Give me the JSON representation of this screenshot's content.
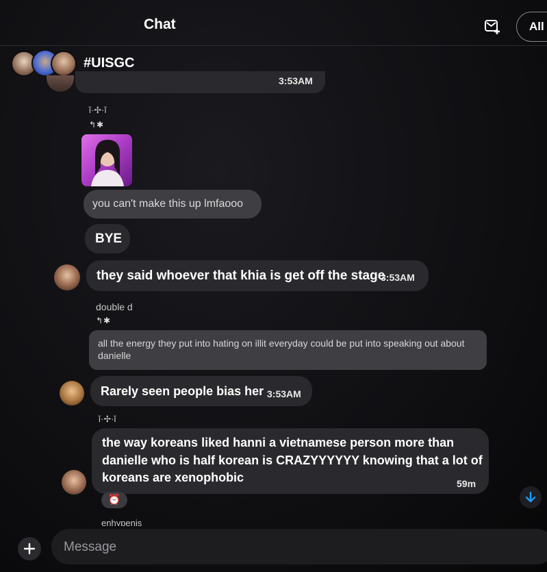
{
  "header": {
    "title": "Chat",
    "filter_label": "All"
  },
  "group": {
    "name": "#UISGC"
  },
  "messages": {
    "top_partial": {
      "text": "...",
      "time": "3:53AM"
    },
    "reply_1": {
      "sender": "ǐ·✢·ǐ",
      "icons": "↰✱"
    },
    "m1": {
      "text": "you can't make this up lmfaooo"
    },
    "m2": {
      "text": "BYE"
    },
    "m3": {
      "text": "they said whoever that khia is get off the stage",
      "time": "3:53AM"
    },
    "reply_2": {
      "sender": "double d",
      "icons": "↰✱",
      "quote": "all the energy they put into hating on illit everyday could be put into speaking out about danielle"
    },
    "m4": {
      "text": "Rarely seen people bias her",
      "time": "3:53AM"
    },
    "reply_3": {
      "sender": "ǐ·✢·ǐ"
    },
    "m5": {
      "line1": "the way koreans liked hanni a vietnamese person more than",
      "line2": "danielle who is half korean is CRAZYYYYYY knowing that a lot of",
      "line3": "koreans are xenophobic",
      "time": "59m",
      "reaction": "⏰"
    },
    "bottom_partial": {
      "sender": "enhypenis"
    }
  },
  "composer": {
    "placeholder": "Message"
  },
  "colors": {
    "background": "#0b0b0d",
    "bubble": "#2a2a2e",
    "quote_bubble": "#3e3e43",
    "scroll_accent": "#1d9bf0"
  },
  "icons": [
    "compose-message-icon",
    "reply-arrow-icon",
    "sparkle-icon",
    "arrow-down-icon",
    "plus-icon",
    "alarm-clock-icon"
  ]
}
